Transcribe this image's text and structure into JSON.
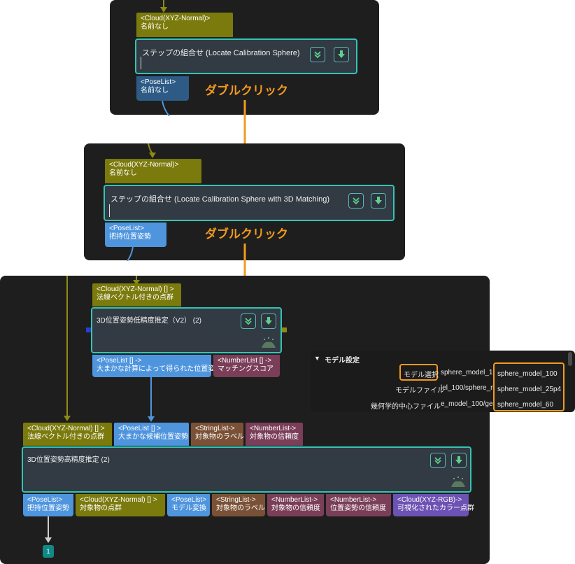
{
  "top": {
    "input_port": {
      "type": "<Cloud(XYZ-Normal)>",
      "name": "名前なし"
    },
    "node_title": "ステップの組合せ (Locate Calibration Sphere)",
    "output_port": {
      "type": "<PoseList>",
      "name": "名前なし"
    },
    "double_click": "ダブルクリック"
  },
  "middle": {
    "input_port": {
      "type": "<Cloud(XYZ-Normal)>",
      "name": "名前なし"
    },
    "node_title": "ステップの組合せ (Locate Calibration Sphere with 3D Matching)",
    "output_port": {
      "type": "<PoseList>",
      "name": "把持位置姿勢"
    },
    "double_click": "ダブルクリック"
  },
  "bottom": {
    "coarse": {
      "input_port": {
        "type": "<Cloud(XYZ-Normal) [] >",
        "name": "法線ベクトル付きの点群"
      },
      "title": "3D位置姿勢低精度推定（V2） (2)",
      "outputs": [
        {
          "type": "<PoseList [] ->",
          "name": "大まかな計算によって得られた位置姿勢"
        },
        {
          "type": "<NumberList [] ->",
          "name": "マッチングスコア"
        }
      ]
    },
    "fine": {
      "inputs": [
        {
          "type": "<Cloud(XYZ-Normal) [] >",
          "name": "法線ベクトル付きの点群"
        },
        {
          "type": "<PoseList [] >",
          "name": "大まかな候補位置姿勢"
        },
        {
          "type": "<StringList->",
          "name": "対象物のラベル"
        },
        {
          "type": "<NumberList->",
          "name": "対象物の信頼度"
        }
      ],
      "title": "3D位置姿勢高精度推定 (2)",
      "outputs": [
        {
          "type": "<PoseList>",
          "name": "把持位置姿勢"
        },
        {
          "type": "<Cloud(XYZ-Normal) [] >",
          "name": "対象物の点群"
        },
        {
          "type": "<PoseList>",
          "name": "モデル変換"
        },
        {
          "type": "<StringList->",
          "name": "対象物のラベル"
        },
        {
          "type": "<NumberList->",
          "name": "対象物の信頼度"
        },
        {
          "type": "<NumberList->",
          "name": "位置姿勢の信頼度"
        },
        {
          "type": "<Cloud(XYZ-RGB)->",
          "name": "可視化されたカラー点群"
        }
      ]
    },
    "badge": "1"
  },
  "settings": {
    "header": "モデル設定",
    "rows": [
      {
        "label": "モデル選択",
        "value": "sphere_model_10"
      },
      {
        "label": "モデルファイル",
        "value": "lel_100/sphere_m"
      },
      {
        "label": "幾何学的中心ファイル",
        "value": "e_model_100/geo"
      }
    ],
    "dropdown": [
      "sphere_model_100",
      "sphere_model_25p4",
      "sphere_model_60"
    ]
  },
  "colors": {
    "accent": "#f39a1e",
    "node_border": "#33c4b4",
    "panel": "#1e1e1e"
  }
}
